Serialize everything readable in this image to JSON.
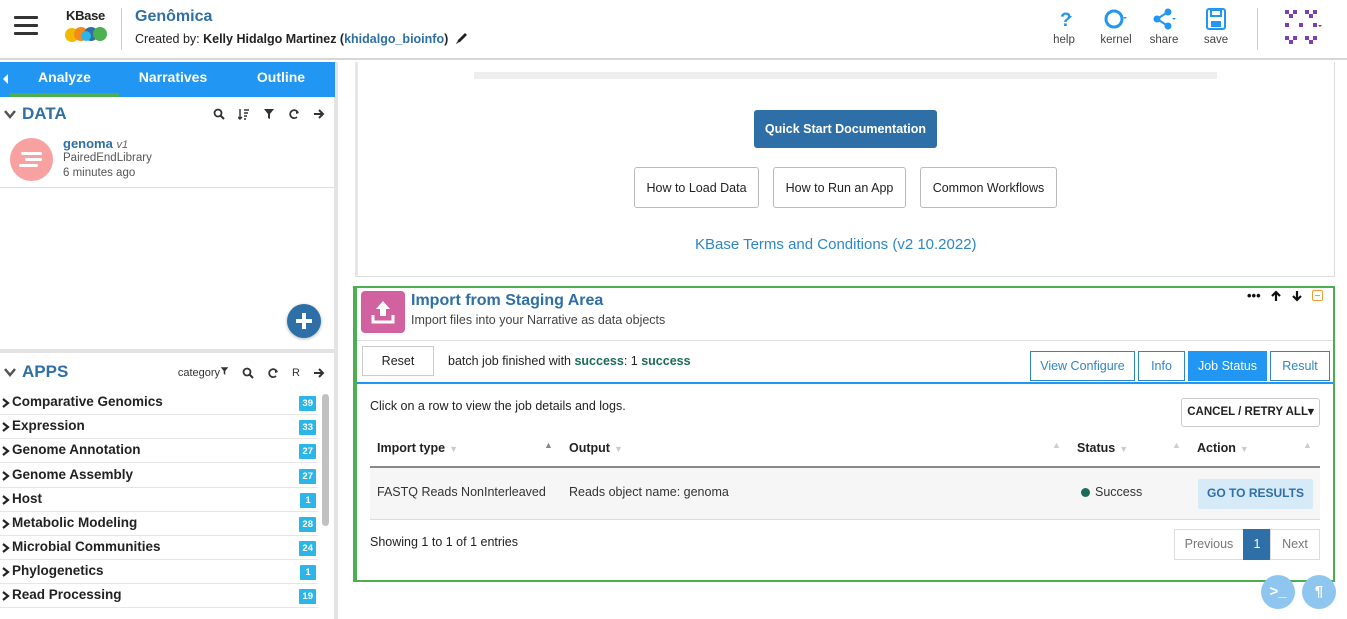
{
  "header": {
    "logo_text": "KBase",
    "narrative_title": "Genômica",
    "created_prefix": "Created by: ",
    "author_name": "Kelly Hidalgo Martinez",
    "author_open": " (",
    "author_username": "khidalgo_bioinfo",
    "author_close": ")",
    "buttons": [
      {
        "label": "help",
        "icon": "question-icon"
      },
      {
        "label": "kernel",
        "icon": "kernel-circle-icon"
      },
      {
        "label": "share",
        "icon": "share-icon"
      },
      {
        "label": "save",
        "icon": "save-icon"
      }
    ],
    "accent_color": "#2196f3"
  },
  "sidebar": {
    "tabs": [
      "Analyze",
      "Narratives",
      "Outline"
    ],
    "active_tab": "Analyze",
    "data_title": "DATA",
    "data_items": [
      {
        "name": "genoma",
        "version": "v1",
        "type": "PairedEndLibrary",
        "time": "6 minutes ago"
      }
    ],
    "apps_title": "APPS",
    "apps_filter_label": "category",
    "apps_r_label": "R",
    "apps": [
      {
        "label": "Comparative Genomics",
        "count": "39"
      },
      {
        "label": "Expression",
        "count": "33"
      },
      {
        "label": "Genome Annotation",
        "count": "27"
      },
      {
        "label": "Genome Assembly",
        "count": "27"
      },
      {
        "label": "Host",
        "count": "1"
      },
      {
        "label": "Metabolic Modeling",
        "count": "28"
      },
      {
        "label": "Microbial Communities",
        "count": "24"
      },
      {
        "label": "Phylogenetics",
        "count": "1"
      },
      {
        "label": "Read Processing",
        "count": "19"
      }
    ]
  },
  "intro_cell": {
    "quick_start": "Quick Start Documentation",
    "links": [
      "How to Load Data",
      "How to Run an App",
      "Common Workflows"
    ],
    "terms": "KBase Terms and Conditions (v2 10.2022)"
  },
  "import_cell": {
    "title": "Import from Staging Area",
    "subtitle": "Import files into your Narrative as data objects",
    "reset_label": "Reset",
    "batch_prefix": "batch job finished with ",
    "batch_success": "success",
    "batch_mid": ": 1 ",
    "batch_success2": "success",
    "tabs": [
      "View Configure",
      "Info",
      "Job Status",
      "Result"
    ],
    "active_tab": "Job Status",
    "click_note": "Click on a row to view the job details and logs.",
    "cancel_label": "CANCEL / RETRY ALL",
    "columns": [
      "Import type",
      "Output",
      "Status",
      "Action"
    ],
    "rows": [
      {
        "import_type": "FASTQ Reads NonInterleaved",
        "output": "Reads object name: genoma",
        "status": "Success",
        "action": "GO TO RESULTS"
      }
    ],
    "showing": "Showing 1 to 1 of 1 entries",
    "pager": {
      "prev": "Previous",
      "current": "1",
      "next": "Next"
    },
    "status_color": "#1a6d56"
  }
}
